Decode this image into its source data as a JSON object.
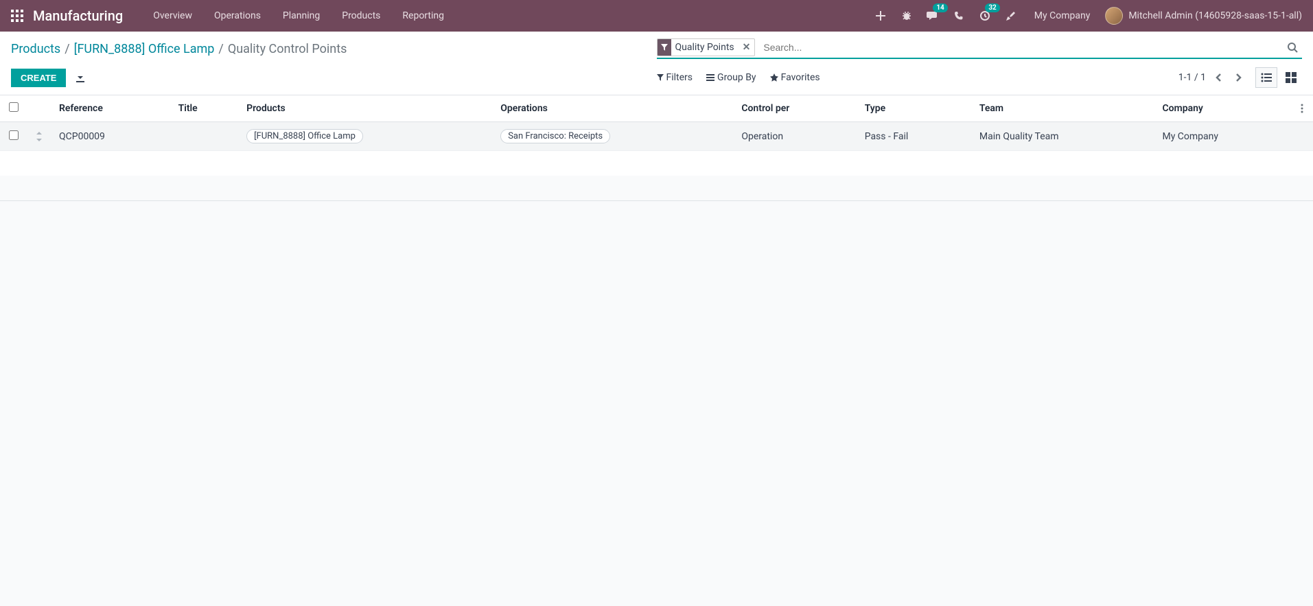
{
  "navbar": {
    "brand": "Manufacturing",
    "menu": [
      "Overview",
      "Operations",
      "Planning",
      "Products",
      "Reporting"
    ],
    "messaging_badge": "14",
    "activities_badge": "32",
    "company": "My Company",
    "username": "Mitchell Admin (14605928-saas-15-1-all)"
  },
  "breadcrumb": {
    "items": [
      "Products",
      "[FURN_8888] Office Lamp"
    ],
    "current": "Quality Control Points"
  },
  "search": {
    "facet_label": "Quality Points",
    "placeholder": "Search..."
  },
  "buttons": {
    "create": "CREATE"
  },
  "search_options": {
    "filters": "Filters",
    "group_by": "Group By",
    "favorites": "Favorites"
  },
  "pager": {
    "range": "1-1",
    "sep": "/",
    "total": "1"
  },
  "table": {
    "headers": {
      "reference": "Reference",
      "title": "Title",
      "products": "Products",
      "operations": "Operations",
      "control_per": "Control per",
      "type": "Type",
      "team": "Team",
      "company": "Company"
    },
    "rows": [
      {
        "reference": "QCP00009",
        "title": "",
        "products": "[FURN_8888] Office Lamp",
        "operations": "San Francisco: Receipts",
        "control_per": "Operation",
        "type": "Pass - Fail",
        "team": "Main Quality Team",
        "company": "My Company"
      }
    ]
  }
}
